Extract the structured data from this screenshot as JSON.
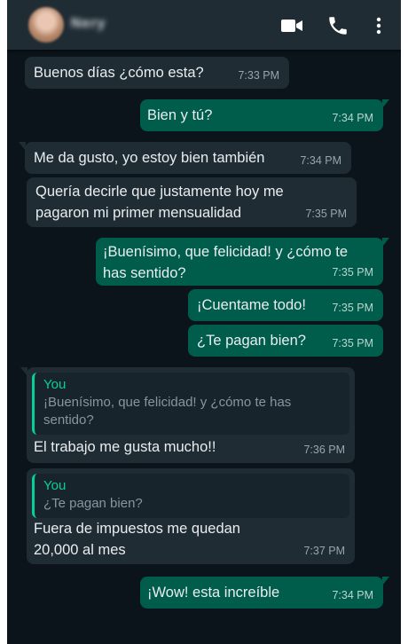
{
  "header": {
    "contact_name": "Nery",
    "icons": [
      "video-call-icon",
      "phone-call-icon",
      "more-options-icon"
    ]
  },
  "messages": [
    {
      "dir": "in",
      "text": "Buenos días ¿cómo esta?",
      "time": "7:33 PM"
    },
    {
      "dir": "out",
      "text": "Bien y tú?",
      "time": "7:34 PM"
    },
    {
      "dir": "in",
      "text": "Me da gusto, yo estoy bien también",
      "time": "7:34 PM"
    },
    {
      "dir": "in",
      "text": "Quería decirle que justamente hoy me\npagaron mi primer mensualidad",
      "time": "7:35 PM"
    },
    {
      "dir": "out",
      "text": "¡Buenísimo, que felicidad! y ¿cómo te\nhas sentido?",
      "time": "7:35 PM"
    },
    {
      "dir": "out",
      "text": "¡Cuentame todo!",
      "time": "7:35 PM"
    },
    {
      "dir": "out",
      "text": "¿Te pagan bien?",
      "time": "7:35 PM"
    },
    {
      "dir": "in",
      "text": "El trabajo me gusta mucho!!",
      "time": "7:36 PM",
      "quote": {
        "author": "You",
        "text": "¡Buenísimo, que felicidad! y ¿cómo te has\nsentido?"
      }
    },
    {
      "dir": "in",
      "text": "Fuera de impuestos me quedan\n20,000 al mes",
      "time": "7:37 PM",
      "quote": {
        "author": "You",
        "text": "¿Te pagan bien?"
      }
    },
    {
      "dir": "out",
      "text": "¡Wow! esta increíble",
      "time": "7:34 PM"
    }
  ],
  "colors": {
    "background": "#0b141a",
    "header": "#1f2c34",
    "incoming_bubble": "#1f2c34",
    "outgoing_bubble": "#005c4b",
    "quote_accent": "#06cf9c"
  }
}
